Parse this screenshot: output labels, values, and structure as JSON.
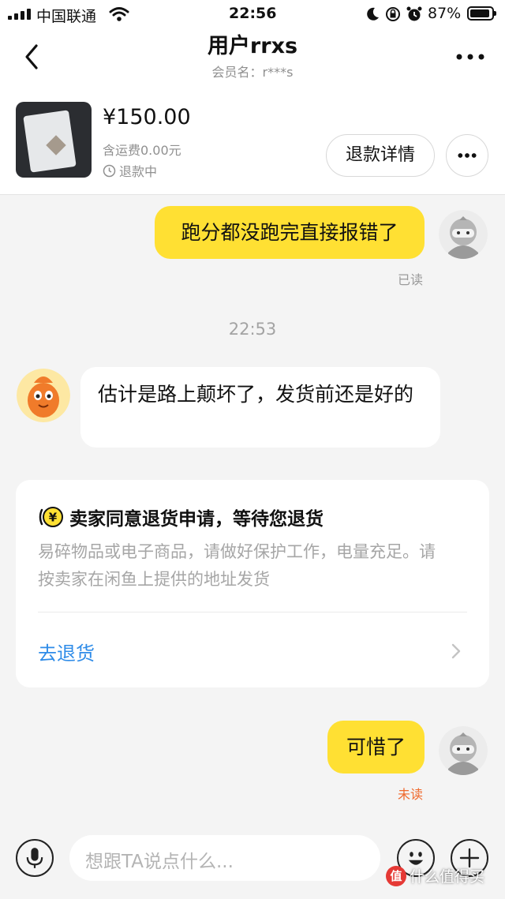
{
  "status_bar": {
    "carrier": "中国联通",
    "time": "22:56",
    "battery": "87%",
    "battery_level": 0.87,
    "icons": [
      "signal-icon",
      "wifi-icon",
      "moon-icon",
      "rotation-lock-icon",
      "alarm-icon",
      "battery-icon"
    ]
  },
  "header": {
    "back_icon": "chevron-left-icon",
    "title": "用户rrxs",
    "subtitle": "会员名：r***s",
    "more_icon": "more-dots-icon"
  },
  "product": {
    "price": "¥150.00",
    "shipping": "含运费0.00元",
    "status": "退款中",
    "status_icon": "clock-icon",
    "refund_button": "退款详情",
    "more_button_icon": "more-dots-icon"
  },
  "messages": [
    {
      "side": "right",
      "text": "跑分都没跑完直接报错了",
      "receipt": "已读"
    },
    {
      "timestamp": "22:53"
    },
    {
      "side": "left",
      "text": "估计是路上颠坏了，发货前还是好的"
    },
    {
      "side": "right",
      "text": "可惜了",
      "receipt": "未读"
    }
  ],
  "card": {
    "icon": "yuan-coin-icon",
    "title": "卖家同意退货申请，等待您退货",
    "description": "易碎物品或电子商品，请做好保护工作，电量充足。请按卖家在闲鱼上提供的地址发货",
    "action": "去退货"
  },
  "input_bar": {
    "placeholder": "想跟TA说点什么...",
    "voice_icon": "microphone-icon",
    "emoji_icon": "emoji-icon",
    "plus_icon": "plus-icon"
  },
  "watermark": {
    "badge": "值",
    "text": "什么值得买"
  },
  "colors": {
    "accent_yellow": "#ffe033",
    "link_blue": "#2f8ce8",
    "unread_orange": "#ef6a2e",
    "background": "#f4f4f4"
  }
}
